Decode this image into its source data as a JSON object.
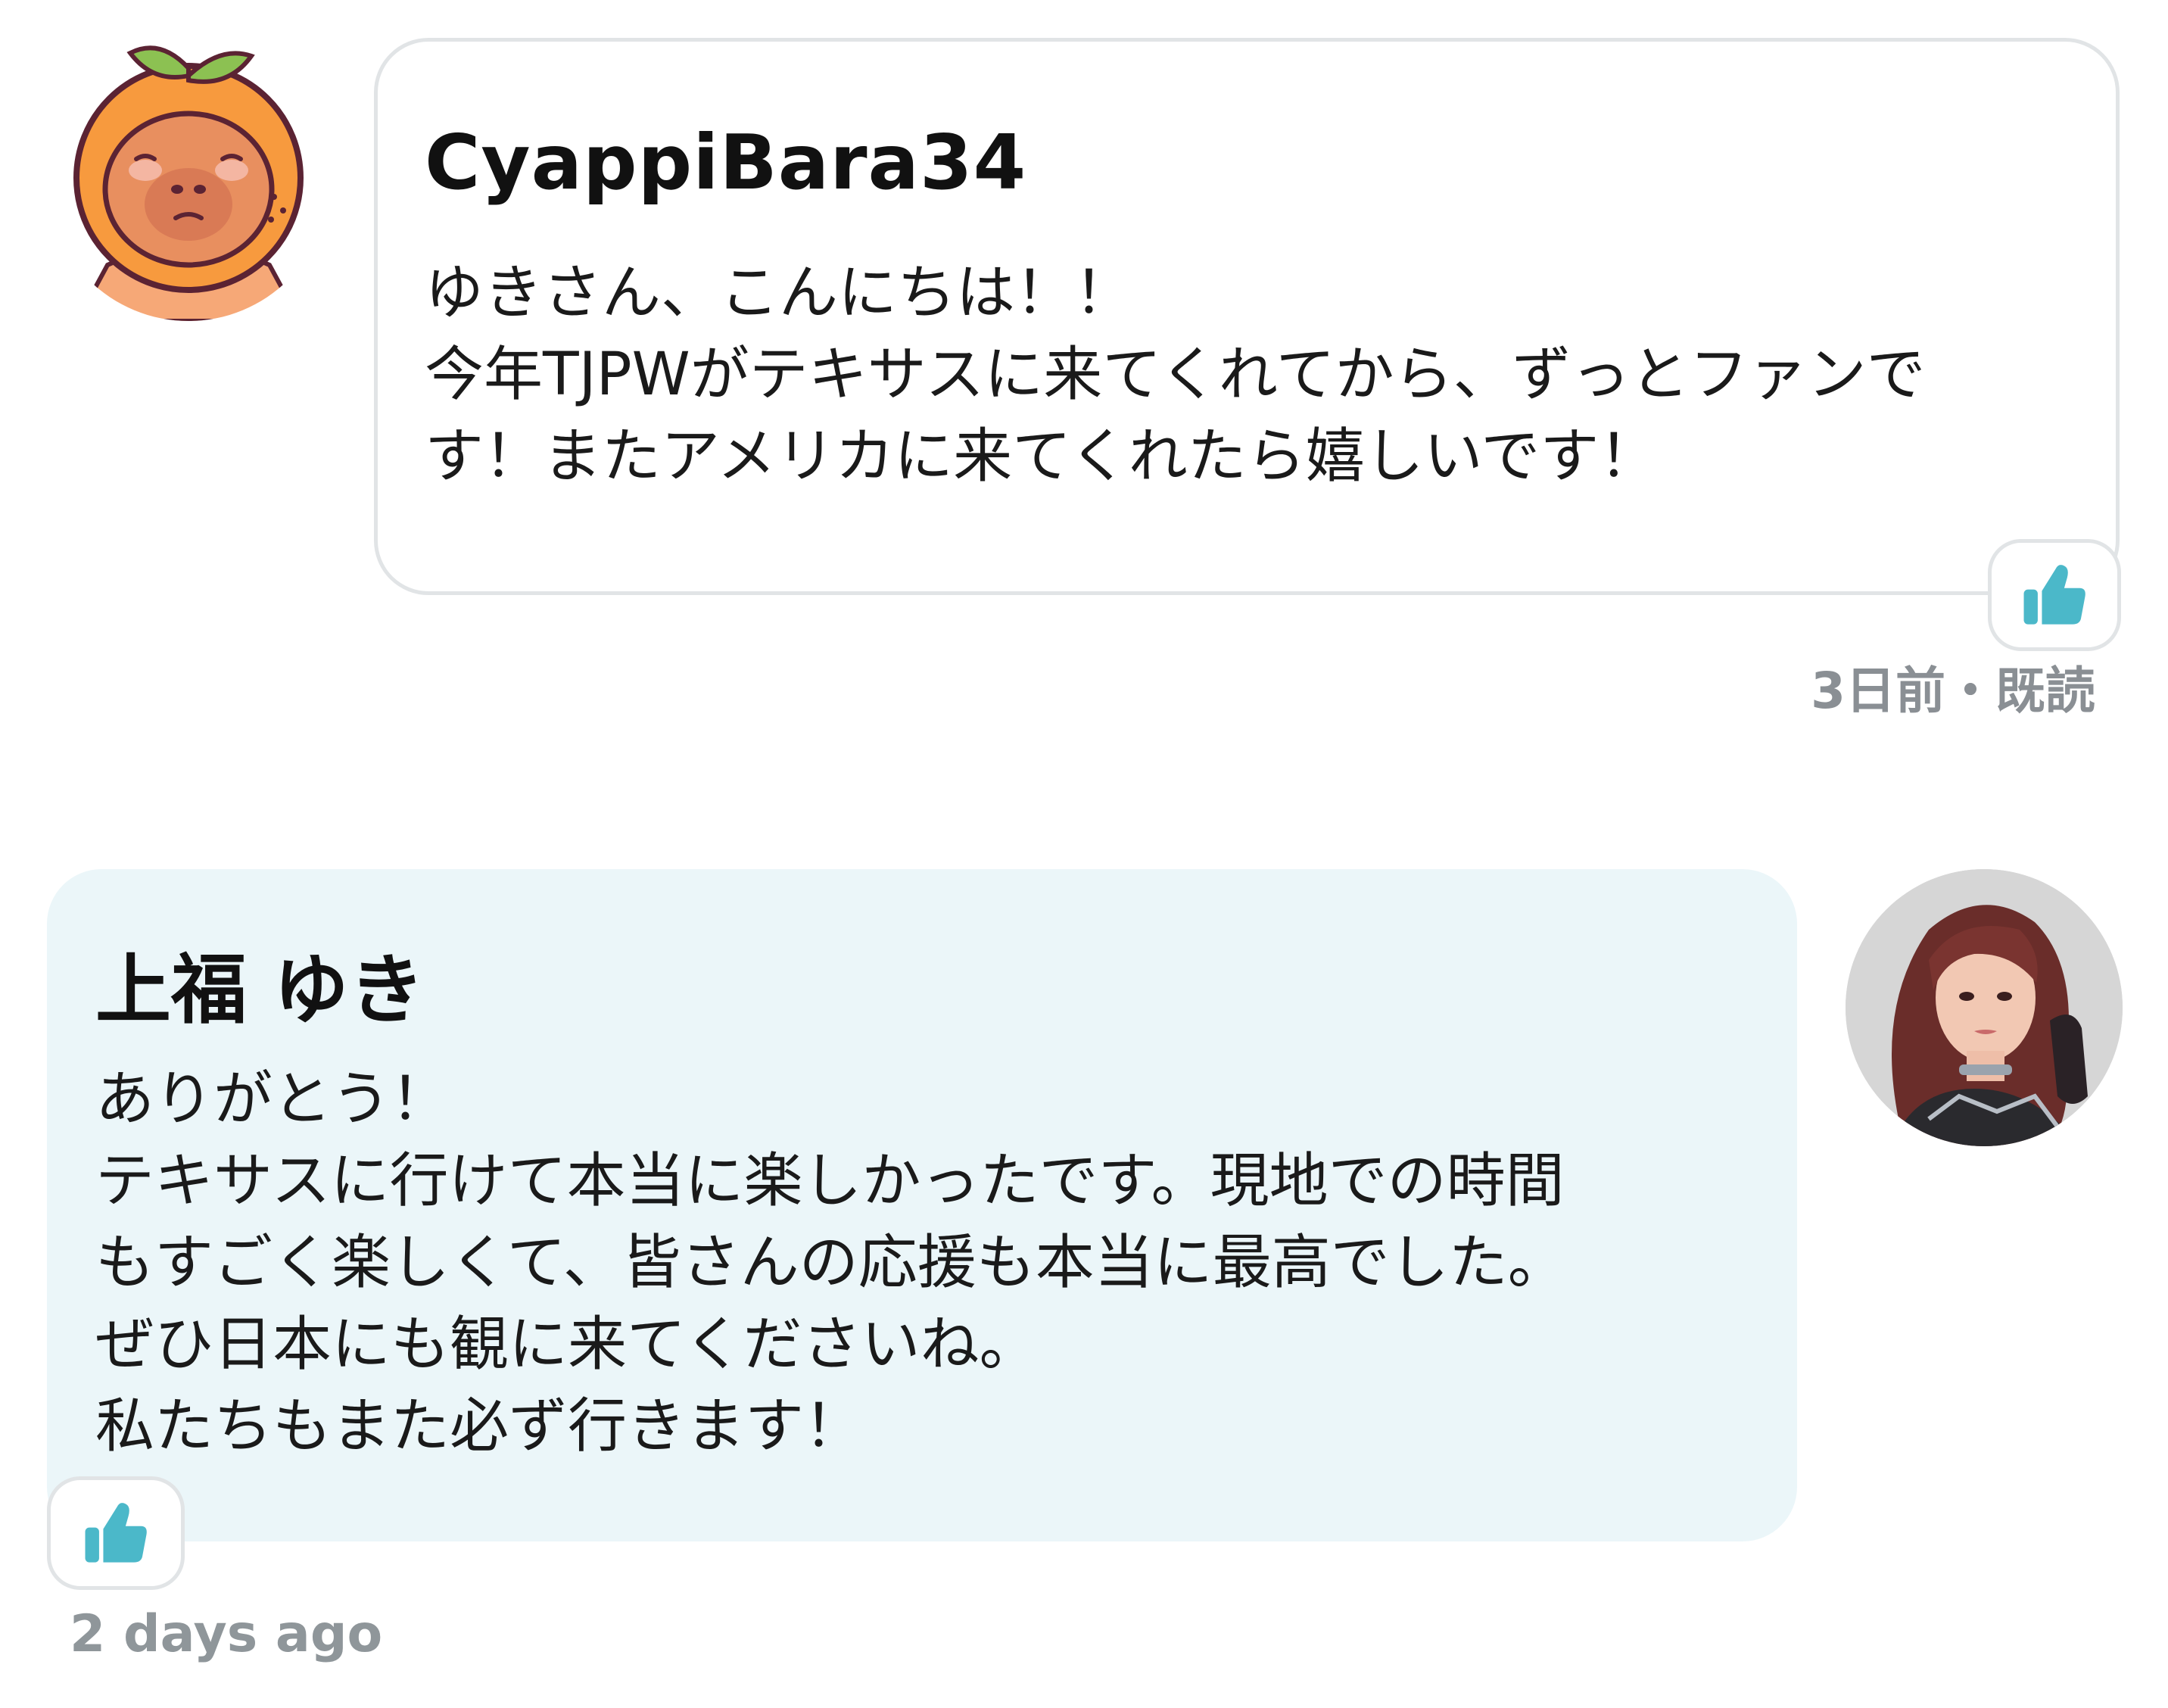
{
  "messages": [
    {
      "sender": "CyappiBara34",
      "avatar_icon": "capybara-orange-avatar",
      "body": "ゆきさん、こんにちは！！\n今年TJPWがテキサスに来てくれてから、ずっとファンで\nす！またアメリカに来てくれたら嬉しいです！",
      "like_icon": "thumbs-up-icon",
      "meta": "3日前・既読"
    },
    {
      "sender": "上福 ゆき",
      "avatar_icon": "profile-photo-avatar",
      "body": "ありがとう！\nテキサスに行けて本当に楽しかったです。現地での時間\nもすごく楽しくて、皆さんの応援も本当に最高でした。\nぜひ日本にも観に来てくださいね。\n私たちもまた必ず行きます！",
      "like_icon": "thumbs-up-icon",
      "meta": "2 days ago"
    }
  ],
  "colors": {
    "accent": "#4bb8c9",
    "bubble_reply_bg": "#ebf6f9",
    "bubble_border": "#e1e4e6",
    "meta_text": "#8a8f94",
    "avatar_orange": "#f6a15e"
  }
}
